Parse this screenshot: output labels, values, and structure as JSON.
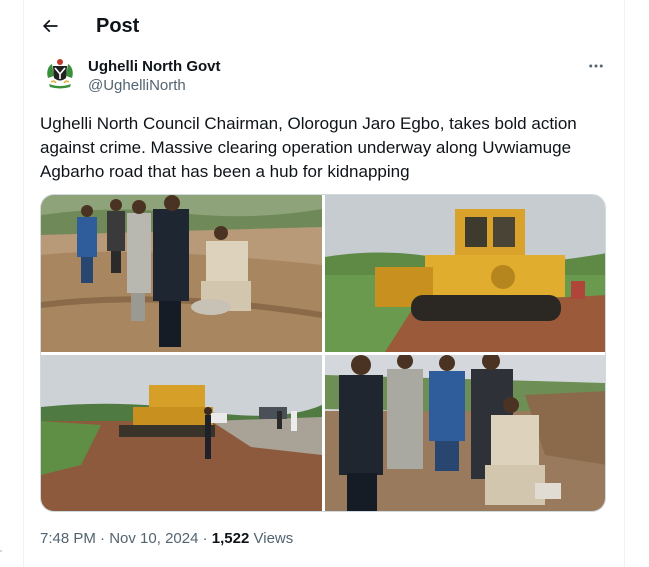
{
  "header": {
    "title": "Post",
    "back_icon": "arrow-left-icon"
  },
  "author": {
    "name": "Ughelli North Govt",
    "handle": "@UghelliNorth",
    "avatar_icon": "coat-of-arms-icon",
    "more_icon": "more-horizontal-icon"
  },
  "post": {
    "text": "Ughelli North Council Chairman, Olorogun Jaro Egbo, takes bold action against crime. Massive clearing operation underway along Uvwiamuge Agbarho road that has been a hub for kidnapping"
  },
  "media": {
    "photos": [
      "officials-on-site-photo",
      "bulldozer-clearing-photo",
      "bulldozer-road-photo",
      "officials-inspecting-photo"
    ]
  },
  "meta": {
    "time": "7:48 PM",
    "separator1": " · ",
    "date": "Nov 10, 2024",
    "separator2": " · ",
    "views_count": "1,522",
    "views_label": " Views"
  },
  "colors": {
    "text_primary": "#0f1419",
    "text_secondary": "#536471",
    "border": "#cfd9de"
  }
}
